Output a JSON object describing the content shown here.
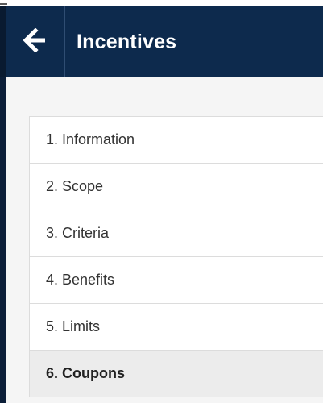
{
  "header": {
    "title": "Incentives"
  },
  "icons": {
    "back": "arrow-left-icon"
  },
  "colors": {
    "header_bg": "#0d2a4d",
    "active_item_bg": "#ececec"
  },
  "steps": [
    {
      "label": "1. Information",
      "active": false
    },
    {
      "label": "2. Scope",
      "active": false
    },
    {
      "label": "3. Criteria",
      "active": false
    },
    {
      "label": "4. Benefits",
      "active": false
    },
    {
      "label": "5. Limits",
      "active": false
    },
    {
      "label": "6. Coupons",
      "active": true
    }
  ]
}
